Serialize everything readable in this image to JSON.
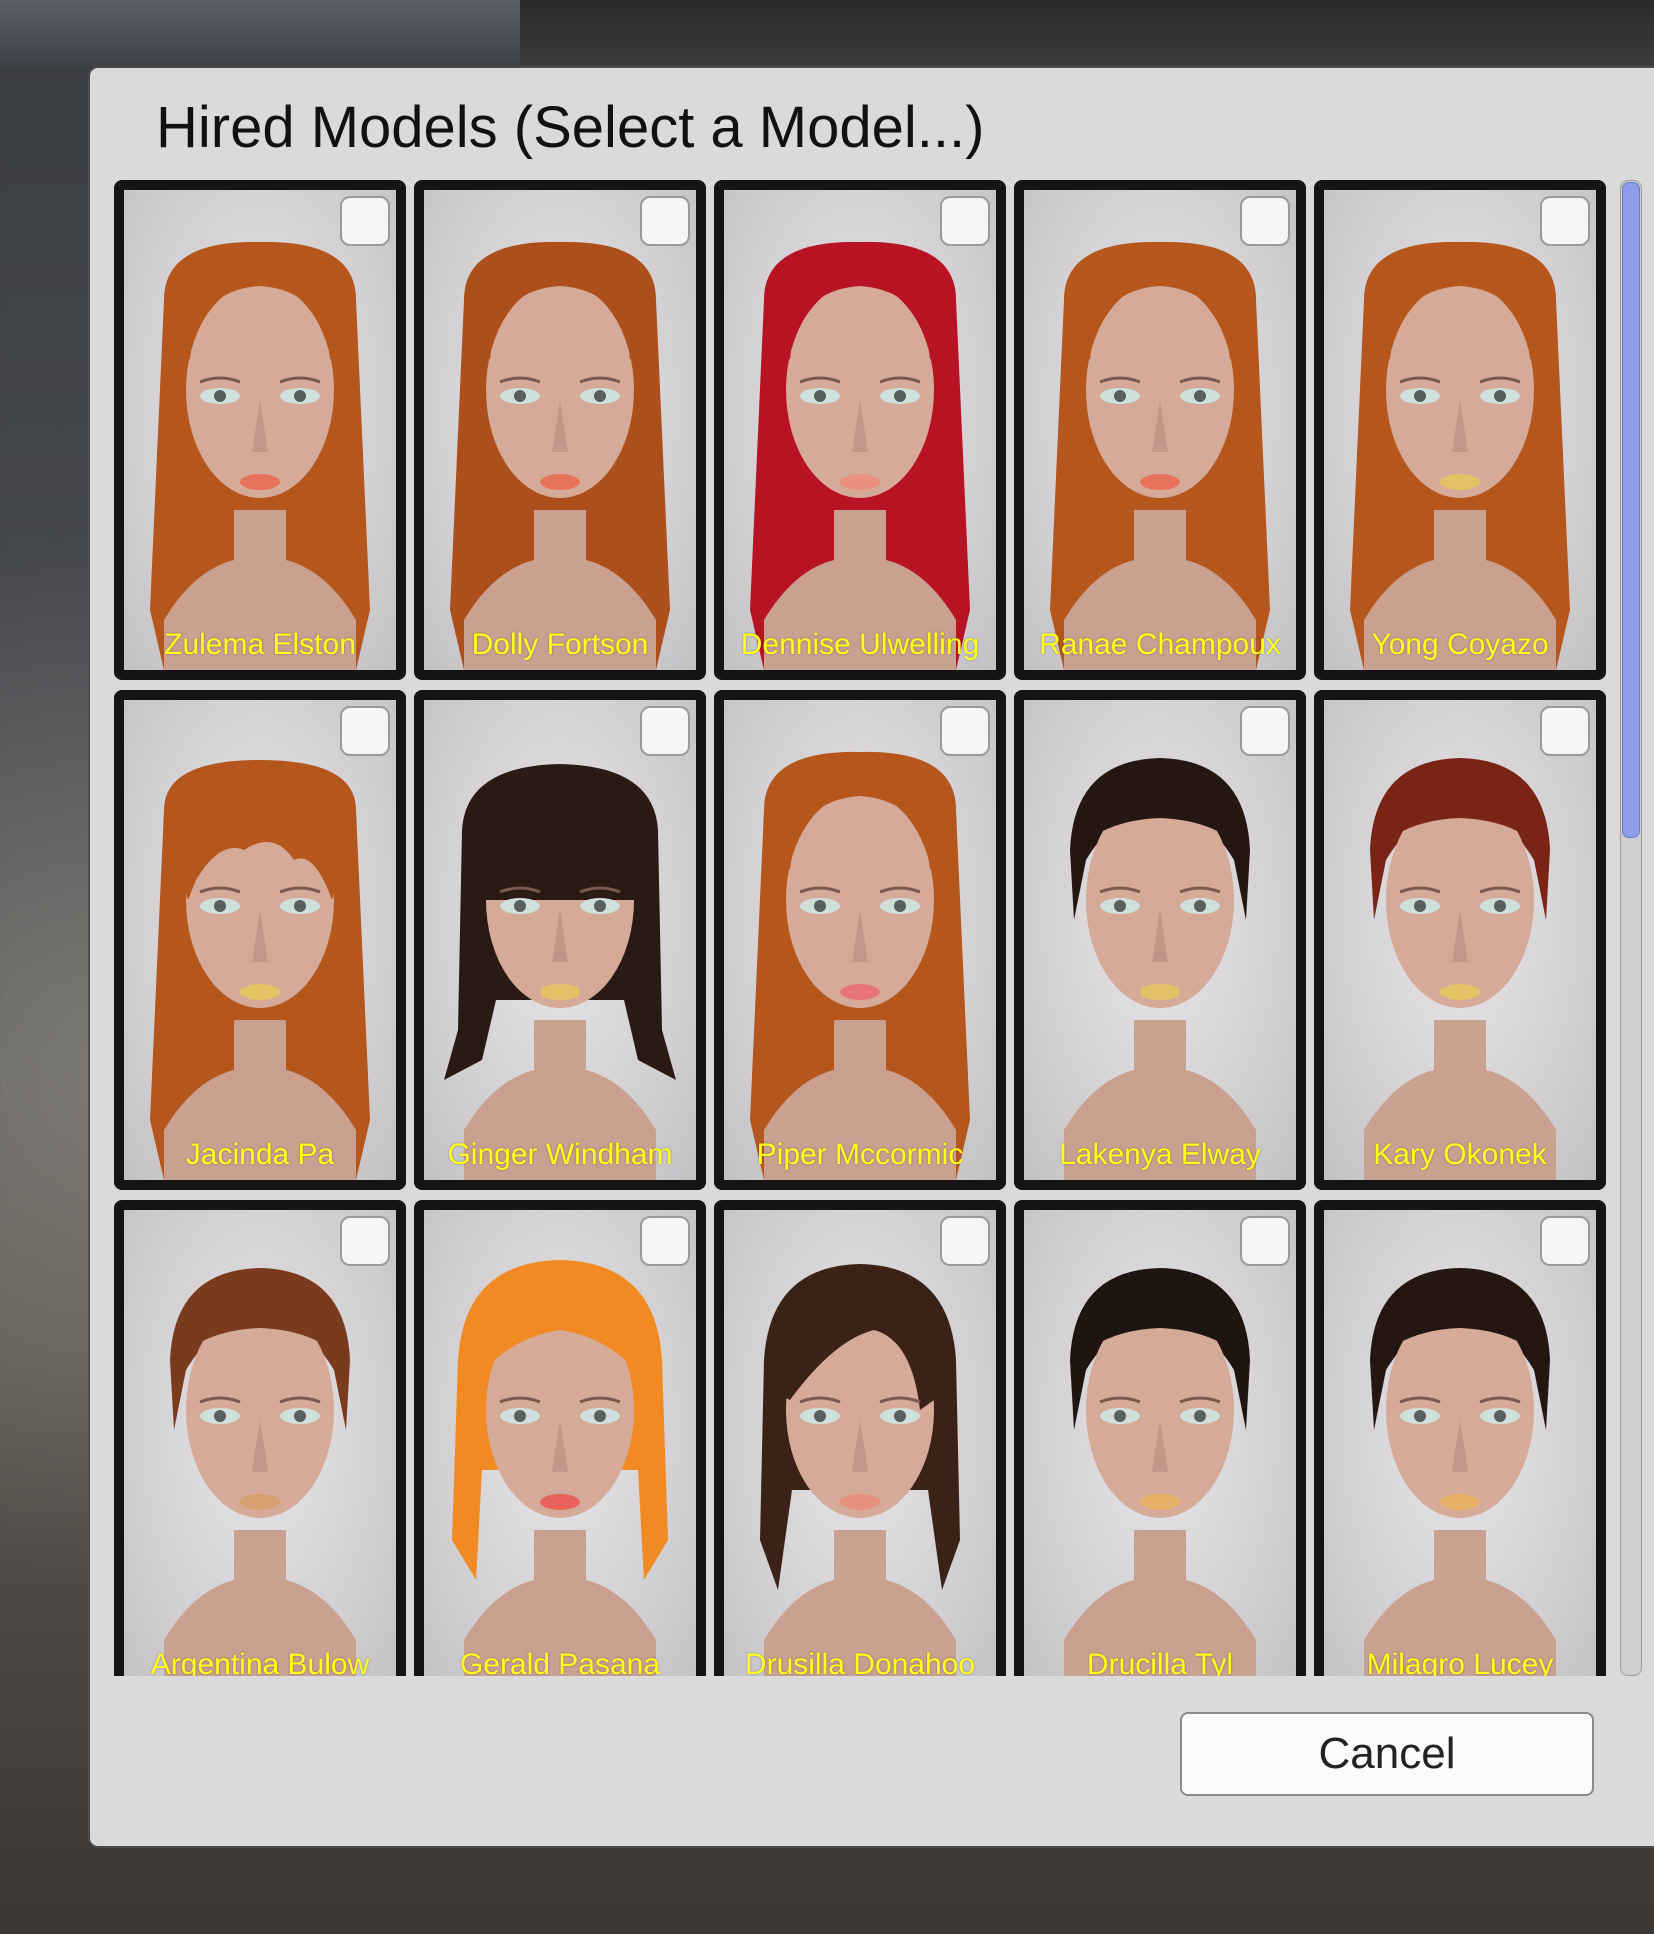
{
  "dialog": {
    "title": "Hired Models (Select a Model...)",
    "cancel_label": "Cancel"
  },
  "colors": {
    "name_text": "#ffff1a",
    "scroll_thumb": "#8d9dec",
    "dialog_bg": "#dadada"
  },
  "models": [
    {
      "name": "Zulema Elston",
      "hair": "#b5561c",
      "style": "long",
      "lips": "#e8735d"
    },
    {
      "name": "Dolly Fortson",
      "hair": "#ad4f1b",
      "style": "long",
      "lips": "#e8735d"
    },
    {
      "name": "Dennise Ulwelling",
      "hair": "#b81322",
      "style": "long",
      "lips": "#e9917e"
    },
    {
      "name": "Ranae Champoux",
      "hair": "#b5561c",
      "style": "long",
      "lips": "#e8735d"
    },
    {
      "name": "Yong Coyazo",
      "hair": "#b5561c",
      "style": "long",
      "lips": "#e6c266"
    },
    {
      "name": "Jacinda Pa",
      "hair": "#b5561c",
      "style": "long-bangs",
      "lips": "#e6c266"
    },
    {
      "name": "Ginger Windham",
      "hair": "#2a1a14",
      "style": "bob-bangs",
      "lips": "#e6c266"
    },
    {
      "name": "Piper Mccormic",
      "hair": "#b5561c",
      "style": "long",
      "lips": "#e8737a"
    },
    {
      "name": "Lakenya Elway",
      "hair": "#241610",
      "style": "short",
      "lips": "#e6c266"
    },
    {
      "name": "Kary Okonek",
      "hair": "#7a2416",
      "style": "short",
      "lips": "#e6c266"
    },
    {
      "name": "Argentina Bulow",
      "hair": "#7a3a1e",
      "style": "short",
      "lips": "#d6a070"
    },
    {
      "name": "Gerald Pasana",
      "hair": "#f28a24",
      "style": "bob",
      "lips": "#e8635d"
    },
    {
      "name": "Drusilla Donahoo",
      "hair": "#3a2216",
      "style": "side",
      "lips": "#e8907e"
    },
    {
      "name": "Drucilla Tyl",
      "hair": "#1e1410",
      "style": "short",
      "lips": "#e6b066"
    },
    {
      "name": "Milagro Lucey",
      "hair": "#241610",
      "style": "short",
      "lips": "#e6b066"
    }
  ]
}
